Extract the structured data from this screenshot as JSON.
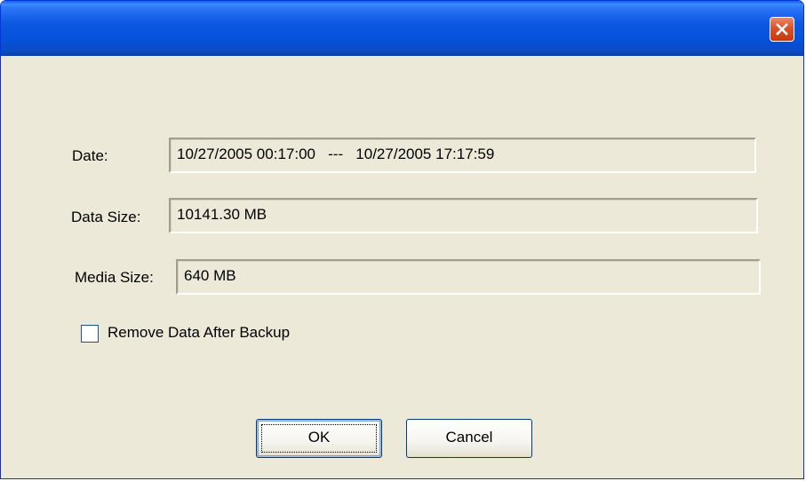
{
  "window": {
    "title": "",
    "close_icon": "close-x-icon",
    "colors": {
      "titlebar": "#0552dc",
      "client": "#ece9d8",
      "close": "#d8532a"
    }
  },
  "form": {
    "date": {
      "label": "Date:",
      "value": "10/27/2005 00:17:00   ---   10/27/2005 17:17:59"
    },
    "data_size": {
      "label": "Data Size:",
      "value": "10141.30 MB"
    },
    "media_size": {
      "label": "Media Size:",
      "value": "640 MB"
    },
    "remove_data": {
      "label": "Remove Data After Backup",
      "checked": false
    }
  },
  "buttons": {
    "ok": "OK",
    "cancel": "Cancel"
  }
}
